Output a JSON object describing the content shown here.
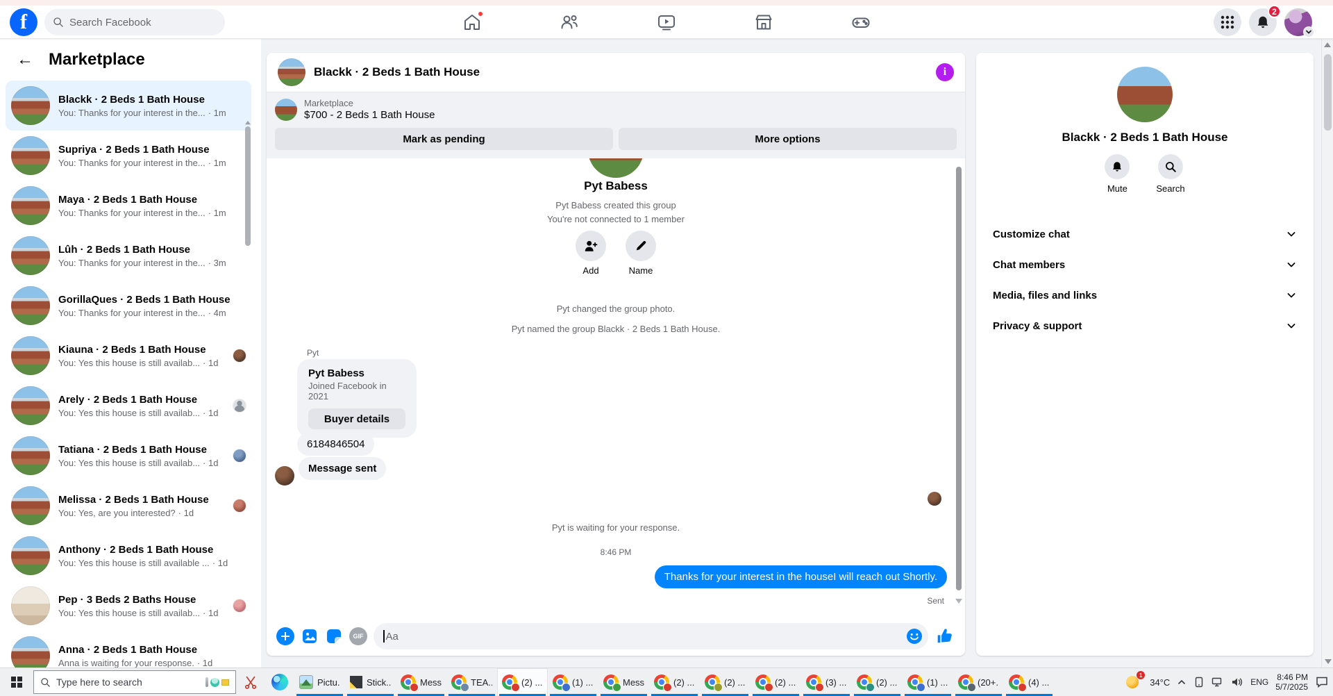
{
  "colors": {
    "facebook_blue": "#0866ff",
    "messenger_blue": "#0084ff",
    "info_purple": "#b41df0",
    "badge_red": "#e41e3f",
    "selected_conversation_bg": "#e7f3ff",
    "taskbar_underline_blue": "#0078d7"
  },
  "icons": {
    "back_arrow": "←",
    "info_i": "i"
  },
  "nav": {
    "search_placeholder": "Search Facebook",
    "notification_count": "2"
  },
  "sidebar": {
    "title": "Marketplace",
    "conversations": [
      {
        "name": "Blackk · 2 Beds 1 Bath House",
        "preview": "You: Thanks for your interest in the...",
        "time": "· 1m"
      },
      {
        "name": "Supriya · 2 Beds 1 Bath House",
        "preview": "You: Thanks for your interest in the...",
        "time": "· 1m"
      },
      {
        "name": "Maya · 2 Beds 1 Bath House",
        "preview": "You: Thanks for your interest in the...",
        "time": "· 1m"
      },
      {
        "name": "Lûh · 2 Beds 1 Bath House",
        "preview": "You: Thanks for your interest in the...",
        "time": "· 3m"
      },
      {
        "name": "GorillaQues · 2 Beds 1 Bath House",
        "preview": "You: Thanks for your interest in the...",
        "time": "· 4m"
      },
      {
        "name": "Kiauna · 2 Beds 1 Bath House",
        "preview": "You: Yes this house is still availab...",
        "time": "· 1d",
        "badge_style": "background:radial-gradient(circle at 38% 30%, #8a5c42 0 30%, #3c2a1e 90%)"
      },
      {
        "name": "Arely · 2 Beds 1 Bath House",
        "preview": "You: Yes this house is still availab...",
        "time": "· 1d",
        "badge_style": "background:radial-gradient(circle at 50% 32%, #8a929c 0 24%, rgba(0,0,0,0) 25%),radial-gradient(circle at 50% 88%, #8a929c 0 40%, rgba(0,0,0,0) 41%),#dde1e6"
      },
      {
        "name": "Tatiana · 2 Beds 1 Bath House",
        "preview": "You: Yes this house is still availab...",
        "time": "· 1d",
        "badge_style": "background:radial-gradient(circle at 38% 30%, #7f9dc4 0 30%, #35517c 90%)"
      },
      {
        "name": "Melissa · 2 Beds 1 Bath House",
        "preview": "You: Yes, are you interested?",
        "time": "· 1d",
        "badge_style": "background:radial-gradient(circle at 38% 30%, #c97b6a 0 30%, #7c3b2e 90%)"
      },
      {
        "name": "Anthony · 2 Beds 1 Bath House",
        "preview": "You: Yes this house is still available ...",
        "time": "· 1d"
      },
      {
        "name": "Pep · 3 Beds 2 Baths House",
        "preview": "You: Yes this house is still availab...",
        "time": "· 1d",
        "badge_style": "background:radial-gradient(circle at 38% 30%, #e9a2a2 0 30%, #b05560 90%)"
      },
      {
        "name": "Anna · 2 Beds 1 Bath House",
        "preview": "Anna is waiting for your response.",
        "time": "· 1d"
      }
    ]
  },
  "chat": {
    "title": "Blackk · 2 Beds 1 Bath House",
    "listing": {
      "source": "Marketplace",
      "price_line": "$700 - 2 Beds 1 Bath House"
    },
    "actions": {
      "mark_pending": "Mark as pending",
      "more_options": "More options"
    },
    "group": {
      "name": "Pyt Babess",
      "created_line": "Pyt Babess created this group",
      "connect_line": "You're not connected to 1 member",
      "add_label": "Add",
      "name_label": "Name"
    },
    "system_messages": [
      "Pyt changed the group photo.",
      "Pyt named the group Blackk · 2 Beds 1 Bath House."
    ],
    "sender_label": "Pyt",
    "buyer_card": {
      "name": "Pyt Babess",
      "joined": "Joined Facebook in 2021",
      "button": "Buyer details"
    },
    "messages": {
      "phone": "6184846504",
      "message_sent": "Message sent"
    },
    "waiting_line": "Pyt is waiting for your response.",
    "timestamp": "8:46 PM",
    "outgoing": {
      "text": "Thanks for your interest in the houseI will reach out Shortly.",
      "status": "Sent"
    },
    "composer": {
      "placeholder": "Aa",
      "gif_label": "GIF"
    }
  },
  "details_panel": {
    "title": "Blackk · 2 Beds 1 Bath House",
    "mute_label": "Mute",
    "search_label": "Search",
    "sections": [
      "Customize chat",
      "Chat members",
      "Media, files and links",
      "Privacy & support"
    ]
  },
  "taskbar": {
    "search_placeholder": "Type here to search",
    "buttons": [
      {
        "label": "Pictu...",
        "icon": "photos"
      },
      {
        "label": "Stick...",
        "icon": "sticky"
      },
      {
        "label": "Mess...",
        "icon": "chrome",
        "badge_style": "background:#d93b2f"
      },
      {
        "label": "TEA...",
        "icon": "chrome",
        "badge_style": "background:#6f88a8"
      },
      {
        "label": "(2) ...",
        "icon": "chrome",
        "badge_style": "background:#d93b2f"
      },
      {
        "label": "(1) ...",
        "icon": "chrome",
        "badge_style": "background:#3f6fd1"
      },
      {
        "label": "Mess...",
        "icon": "chrome",
        "badge_style": "background:#3f9d44"
      },
      {
        "label": "(2) ...",
        "icon": "chrome",
        "badge_style": "background:#d93b2f"
      },
      {
        "label": "(2) ...",
        "icon": "chrome",
        "badge_style": "background:#9c9b2e"
      },
      {
        "label": "(2) ...",
        "icon": "chrome",
        "badge_style": "background:#d93b2f"
      },
      {
        "label": "(3) ...",
        "icon": "chrome",
        "badge_style": "background:#d93b2f"
      },
      {
        "label": "(2) ...",
        "icon": "chrome",
        "badge_style": "background:#2d8f86"
      },
      {
        "label": "(1) ...",
        "icon": "chrome",
        "badge_style": "background:#3f6fd1"
      },
      {
        "label": "(20+...",
        "icon": "chrome",
        "badge_style": "background:#5a6570"
      },
      {
        "label": "(4) ...",
        "icon": "chrome",
        "badge_style": "background:#d93b2f"
      }
    ],
    "tray": {
      "alert_count": "1",
      "temperature": "34°C",
      "language": "ENG",
      "time": "8:46 PM",
      "date": "5/7/2025"
    }
  }
}
